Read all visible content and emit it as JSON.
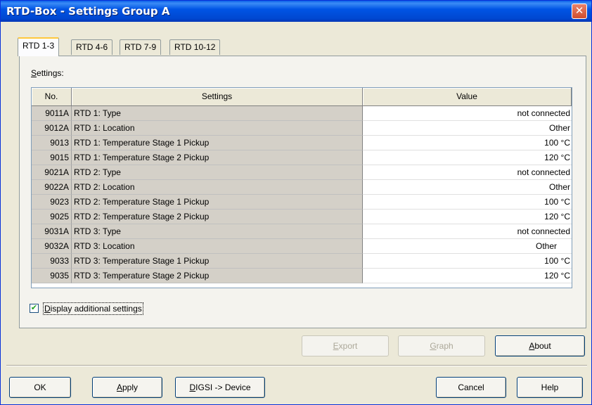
{
  "window": {
    "title": "RTD-Box - Settings Group A",
    "close_glyph": "✕"
  },
  "tabs": [
    {
      "label": "RTD 1-3",
      "active": true
    },
    {
      "label": "RTD 4-6",
      "active": false
    },
    {
      "label": "RTD 7-9",
      "active": false
    },
    {
      "label": "RTD 10-12",
      "active": false
    }
  ],
  "panel": {
    "settings_label_key": "S",
    "settings_label_rest": "ettings:",
    "grid": {
      "headers": {
        "no": "No.",
        "settings": "Settings",
        "value": "Value"
      },
      "rows": [
        {
          "no": "9011A",
          "setting": "RTD 1: Type",
          "value": "not connected"
        },
        {
          "no": "9012A",
          "setting": "RTD 1: Location",
          "value": "Other"
        },
        {
          "no": "9013",
          "setting": "RTD 1: Temperature Stage 1 Pickup",
          "value": "100 °C"
        },
        {
          "no": "9015",
          "setting": "RTD 1: Temperature Stage 2 Pickup",
          "value": "120 °C"
        },
        {
          "no": "9021A",
          "setting": "RTD 2: Type",
          "value": "not connected"
        },
        {
          "no": "9022A",
          "setting": "RTD 2: Location",
          "value": "Other"
        },
        {
          "no": "9023",
          "setting": "RTD 2: Temperature Stage 1 Pickup",
          "value": "100 °C"
        },
        {
          "no": "9025",
          "setting": "RTD 2: Temperature Stage 2 Pickup",
          "value": "120 °C"
        },
        {
          "no": "9031A",
          "setting": "RTD 3: Type",
          "value": "not connected"
        },
        {
          "no": "9032A",
          "setting": "RTD 3: Location",
          "value": "Other"
        },
        {
          "no": "9033",
          "setting": "RTD 3: Temperature Stage 1 Pickup",
          "value": "100 °C"
        },
        {
          "no": "9035",
          "setting": "RTD 3: Temperature Stage 2 Pickup",
          "value": "120 °C"
        }
      ]
    },
    "display_additional": {
      "key": "D",
      "rest": "isplay additional settings",
      "checked": true,
      "check_glyph": "✔"
    }
  },
  "actions": {
    "export": {
      "key": "E",
      "rest": "xport",
      "enabled": false
    },
    "graph": {
      "key": "G",
      "rest": "raph",
      "enabled": false
    },
    "about": {
      "key": "A",
      "rest": "bout",
      "enabled": true
    }
  },
  "footer": {
    "ok": "OK",
    "apply": {
      "key": "A",
      "rest": "pply"
    },
    "digsi": {
      "key": "D",
      "rest": "IGSI -> Device"
    },
    "cancel": "Cancel",
    "help": "Help"
  }
}
